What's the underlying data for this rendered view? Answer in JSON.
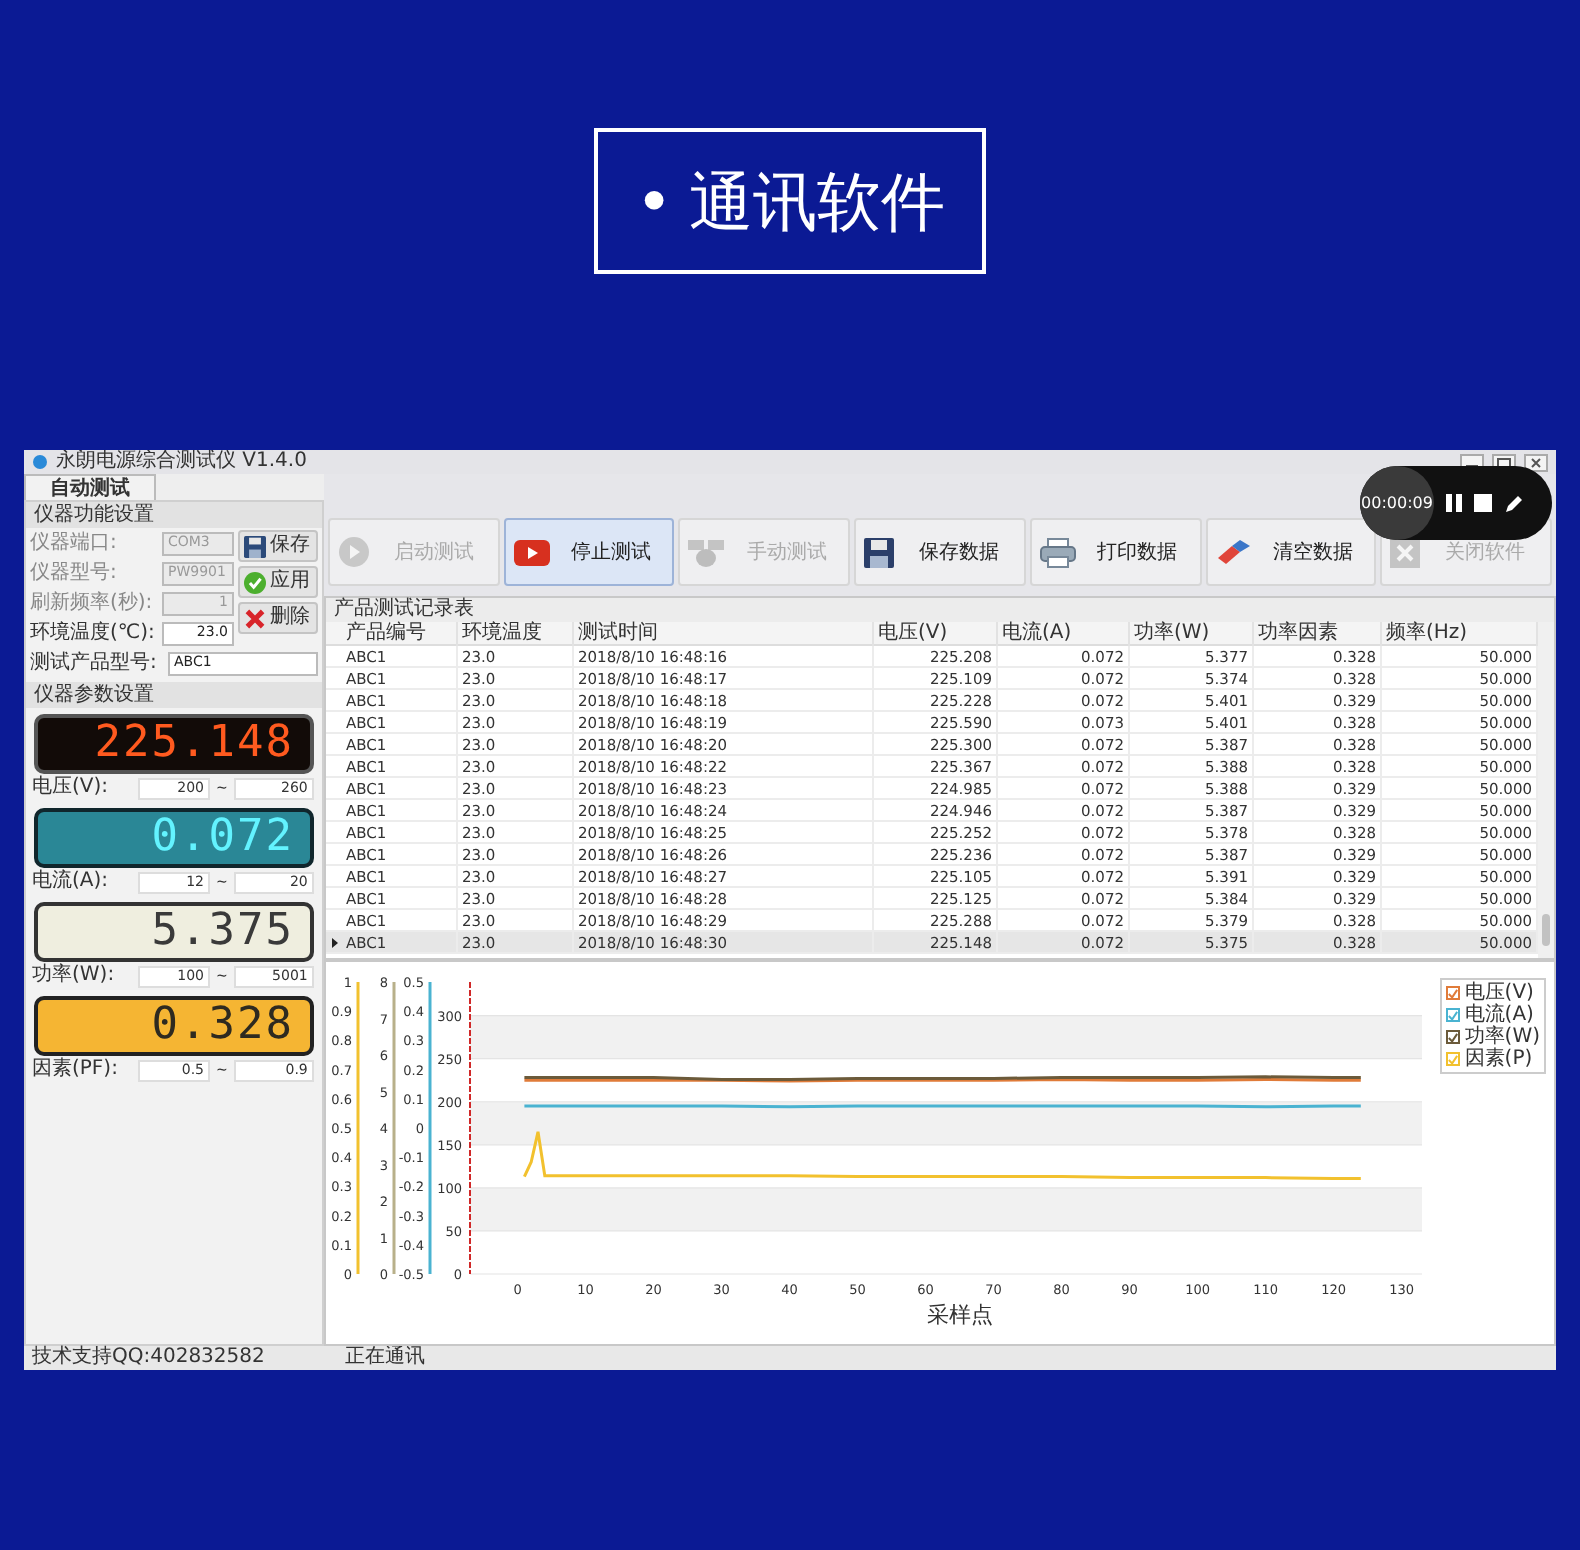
{
  "heading": {
    "bullet": "•",
    "text": "通讯软件"
  },
  "window": {
    "title": "永朗电源综合测试仪 V1.4.0"
  },
  "tabs": [
    {
      "label": "自动测试",
      "selected": true
    }
  ],
  "settings": {
    "title": "仪器功能设置",
    "fields": [
      {
        "label": "仪器端口:",
        "value": "COM3",
        "kind": "select",
        "disabled": true
      },
      {
        "label": "仪器型号:",
        "value": "PW9901",
        "kind": "select",
        "disabled": true
      },
      {
        "label": "刷新频率(秒):",
        "value": "1",
        "kind": "spin",
        "disabled": true
      },
      {
        "label": "环境温度(℃):",
        "value": "23.0",
        "kind": "spin",
        "disabled": false
      },
      {
        "label": "测试产品型号:",
        "value": "ABC1",
        "kind": "select",
        "disabled": false
      }
    ],
    "buttons": [
      {
        "label": "保存",
        "kind": "save"
      },
      {
        "label": "应用",
        "kind": "apply"
      },
      {
        "label": "删除",
        "kind": "delete"
      }
    ]
  },
  "meters": {
    "title": "仪器参数设置",
    "items": [
      {
        "reading": "225.148",
        "kind": "voltage",
        "label": "电压(V):",
        "min": "200",
        "separator": "~",
        "max": "260"
      },
      {
        "reading": "0.072",
        "kind": "current",
        "label": "电流(A):",
        "min": "12",
        "separator": "~",
        "max": "20"
      },
      {
        "reading": "5.375",
        "kind": "power",
        "label": "功率(W):",
        "min": "100",
        "separator": "~",
        "max": "5001"
      },
      {
        "reading": "0.328",
        "kind": "factor",
        "label": "因素(PF):",
        "min": "0.5",
        "separator": "~",
        "max": "0.9"
      }
    ]
  },
  "toolbar": [
    {
      "label": "启动测试",
      "kind": "start",
      "disabled": true,
      "selected": false
    },
    {
      "label": "停止测试",
      "kind": "stop",
      "disabled": false,
      "selected": true
    },
    {
      "label": "手动测试",
      "kind": "manual",
      "disabled": true,
      "selected": false
    },
    {
      "label": "保存数据",
      "kind": "save",
      "disabled": false,
      "selected": false
    },
    {
      "label": "打印数据",
      "kind": "print",
      "disabled": false,
      "selected": false
    },
    {
      "label": "清空数据",
      "kind": "clear",
      "disabled": false,
      "selected": false
    },
    {
      "label": "关闭软件",
      "kind": "close",
      "disabled": true,
      "selected": false
    }
  ],
  "table": {
    "title": "产品测试记录表",
    "columns": [
      "产品编号",
      "环境温度",
      "测试时间",
      "电压(V)",
      "电流(A)",
      "功率(W)",
      "功率因素",
      "频率(Hz)"
    ],
    "rows": [
      {
        "cells": [
          "ABC1",
          "23.0",
          "2018/8/10 16:48:16",
          "225.208",
          "0.072",
          "5.377",
          "0.328",
          "50.000"
        ],
        "selected": false
      },
      {
        "cells": [
          "ABC1",
          "23.0",
          "2018/8/10 16:48:17",
          "225.109",
          "0.072",
          "5.374",
          "0.328",
          "50.000"
        ],
        "selected": false
      },
      {
        "cells": [
          "ABC1",
          "23.0",
          "2018/8/10 16:48:18",
          "225.228",
          "0.072",
          "5.401",
          "0.329",
          "50.000"
        ],
        "selected": false
      },
      {
        "cells": [
          "ABC1",
          "23.0",
          "2018/8/10 16:48:19",
          "225.590",
          "0.073",
          "5.401",
          "0.328",
          "50.000"
        ],
        "selected": false
      },
      {
        "cells": [
          "ABC1",
          "23.0",
          "2018/8/10 16:48:20",
          "225.300",
          "0.072",
          "5.387",
          "0.328",
          "50.000"
        ],
        "selected": false
      },
      {
        "cells": [
          "ABC1",
          "23.0",
          "2018/8/10 16:48:22",
          "225.367",
          "0.072",
          "5.388",
          "0.328",
          "50.000"
        ],
        "selected": false
      },
      {
        "cells": [
          "ABC1",
          "23.0",
          "2018/8/10 16:48:23",
          "224.985",
          "0.072",
          "5.388",
          "0.329",
          "50.000"
        ],
        "selected": false
      },
      {
        "cells": [
          "ABC1",
          "23.0",
          "2018/8/10 16:48:24",
          "224.946",
          "0.072",
          "5.387",
          "0.329",
          "50.000"
        ],
        "selected": false
      },
      {
        "cells": [
          "ABC1",
          "23.0",
          "2018/8/10 16:48:25",
          "225.252",
          "0.072",
          "5.378",
          "0.328",
          "50.000"
        ],
        "selected": false
      },
      {
        "cells": [
          "ABC1",
          "23.0",
          "2018/8/10 16:48:26",
          "225.236",
          "0.072",
          "5.387",
          "0.329",
          "50.000"
        ],
        "selected": false
      },
      {
        "cells": [
          "ABC1",
          "23.0",
          "2018/8/10 16:48:27",
          "225.105",
          "0.072",
          "5.391",
          "0.329",
          "50.000"
        ],
        "selected": false
      },
      {
        "cells": [
          "ABC1",
          "23.0",
          "2018/8/10 16:48:28",
          "225.125",
          "0.072",
          "5.384",
          "0.329",
          "50.000"
        ],
        "selected": false
      },
      {
        "cells": [
          "ABC1",
          "23.0",
          "2018/8/10 16:48:29",
          "225.288",
          "0.072",
          "5.379",
          "0.328",
          "50.000"
        ],
        "selected": false
      },
      {
        "cells": [
          "ABC1",
          "23.0",
          "2018/8/10 16:48:30",
          "225.148",
          "0.072",
          "5.375",
          "0.328",
          "50.000"
        ],
        "selected": true
      }
    ]
  },
  "chart": {
    "extra_axes": [
      {
        "color": "#f2c12e",
        "ticks": [
          "1",
          "0.9",
          "0.8",
          "0.7",
          "0.6",
          "0.5",
          "0.4",
          "0.3",
          "0.2",
          "0.1",
          "0"
        ]
      },
      {
        "color": "#b8b08a",
        "ticks": [
          "8",
          "7",
          "6",
          "5",
          "4",
          "3",
          "2",
          "1",
          "0"
        ]
      },
      {
        "color": "#4ab3d1",
        "ticks": [
          "0.5",
          "0.4",
          "0.3",
          "0.2",
          "0.1",
          "0",
          "-0.1",
          "-0.2",
          "-0.3",
          "-0.4",
          "-0.5"
        ]
      }
    ],
    "legend": [
      {
        "checked": true
      },
      {
        "checked": true
      },
      {
        "checked": true
      },
      {
        "checked": true
      }
    ],
    "chart_data": {
      "type": "line",
      "grid": true,
      "xlabel": "采样点",
      "x": [
        1,
        2,
        3,
        4,
        10,
        20,
        30,
        40,
        50,
        60,
        70,
        80,
        90,
        100,
        110,
        120,
        124
      ],
      "series": [
        {
          "name": "电压(V)",
          "color": "#e07b39",
          "values": [
            225,
            225,
            225,
            225,
            225,
            225,
            225,
            224,
            225,
            225,
            225,
            226,
            225,
            225,
            226,
            225,
            225
          ]
        },
        {
          "name": "电流(A)",
          "color": "#4ab3d1",
          "values": [
            195,
            195,
            195,
            195,
            195,
            195,
            195,
            194,
            195,
            195,
            195,
            195,
            195,
            195,
            194,
            195,
            195
          ]
        },
        {
          "name": "功率(W)",
          "color": "#6b5a3a",
          "values": [
            228,
            228,
            228,
            228,
            228,
            228,
            226,
            226,
            227,
            227,
            227,
            228,
            228,
            228,
            229,
            228,
            228
          ]
        },
        {
          "name": "因素(P)",
          "color": "#f2c12e",
          "values": [
            113,
            130,
            165,
            114,
            114,
            114,
            114,
            114,
            113,
            113,
            113,
            113,
            112,
            112,
            112,
            111,
            111
          ]
        }
      ],
      "xlim": [
        -7,
        133
      ],
      "ylim": [
        0,
        339
      ],
      "xticks": [
        0,
        10,
        20,
        30,
        40,
        50,
        60,
        70,
        80,
        90,
        100,
        110,
        120,
        130
      ],
      "yticks": [
        0,
        50,
        100,
        150,
        200,
        250,
        300
      ]
    }
  },
  "status_bar": [
    "技术支持QQ:402832582",
    "正在通讯"
  ],
  "recorder": {
    "time": "00:00:09"
  }
}
